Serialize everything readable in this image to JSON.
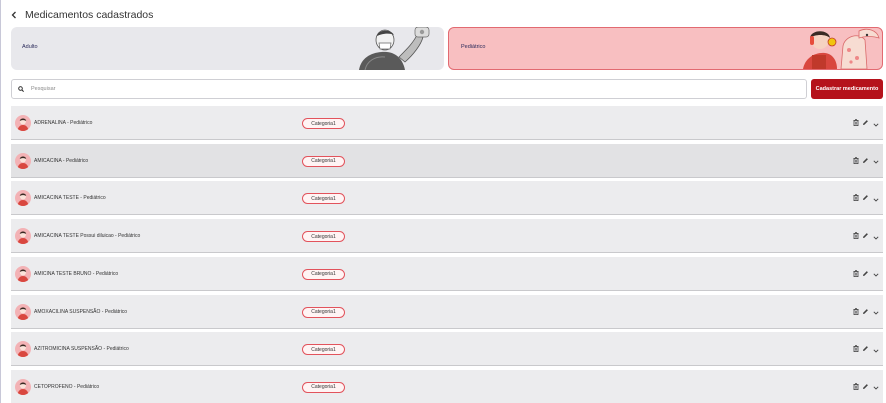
{
  "page": {
    "title": "Medicamentos cadastrados"
  },
  "cards": {
    "adult_label": "Adulto",
    "pediatric_label": "Pediátrico"
  },
  "search": {
    "placeholder": "Pesquisar",
    "value": ""
  },
  "actions": {
    "add_label": "Cadastrar medicamento"
  },
  "colors": {
    "accent": "#b5121b",
    "pediatric_card": "#f8bfc1",
    "pediatric_border": "#e26a71",
    "adult_card": "#e8e8ec",
    "row": "#ececee",
    "badge_border": "#e2535c"
  },
  "icons": [
    "back-icon",
    "search-icon",
    "avatar",
    "trash-icon",
    "pencil-icon",
    "chevron-down-icon"
  ],
  "medications": [
    {
      "name": "ADRENALINA - Pediátrico",
      "category": "Categoria1"
    },
    {
      "name": "AMICACINA - Pediátrico",
      "category": "Categoria1"
    },
    {
      "name": "AMICACINA TESTE - Pediátrico",
      "category": "Categoria1"
    },
    {
      "name": "AMICACINA TESTE Possui diluicao - Pediátrico",
      "category": "Categoria1"
    },
    {
      "name": "AMICINA TESTE BRUNO - Pediátrico",
      "category": "Categoria1"
    },
    {
      "name": "AMOXACILINA SUSPENSÃO - Pediátrico",
      "category": "Categoria1"
    },
    {
      "name": "AZITROMICINA SUSPENSÃO - Pediátrico",
      "category": "Categoria1"
    },
    {
      "name": "CETOPROFENO - Pediátrico",
      "category": "Categoria1"
    }
  ]
}
